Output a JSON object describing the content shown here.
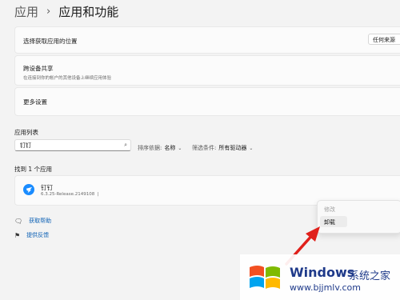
{
  "header": {
    "parent": "应用",
    "separator": "›",
    "title": "应用和功能"
  },
  "rows": {
    "install_location": {
      "label": "选择获取应用的位置",
      "value": "任何来源"
    },
    "share_across_devices": {
      "label": "跨设备共享",
      "description": "在连接到你的帐户的其他设备上继续应用体验"
    },
    "more_settings": {
      "label": "更多设置"
    }
  },
  "app_list": {
    "heading": "应用列表",
    "search_value": "钉钉",
    "sort_label": "排序依据:",
    "sort_value": "名称",
    "filter_label": "筛选条件:",
    "filter_value": "所有驱动器",
    "result_count": "找到 1 个应用",
    "apps": [
      {
        "name": "钉钉",
        "version": "6.3.25-Release.2149108",
        "extra": "|"
      }
    ]
  },
  "links": {
    "help": "获取帮助",
    "feedback": "提供反馈"
  },
  "context_menu": {
    "modify": "修改",
    "uninstall": "卸载"
  },
  "watermark": {
    "brand": "Windows",
    "brand_cn": "系统之家",
    "url": "www.bjjmlv.com"
  },
  "icons": {
    "search": "search-icon",
    "help": "help-icon",
    "feedback": "feedback-icon",
    "app": "dingtalk-icon"
  },
  "colors": {
    "accent": "#0a5fb4",
    "arrow": "#e0201b"
  }
}
